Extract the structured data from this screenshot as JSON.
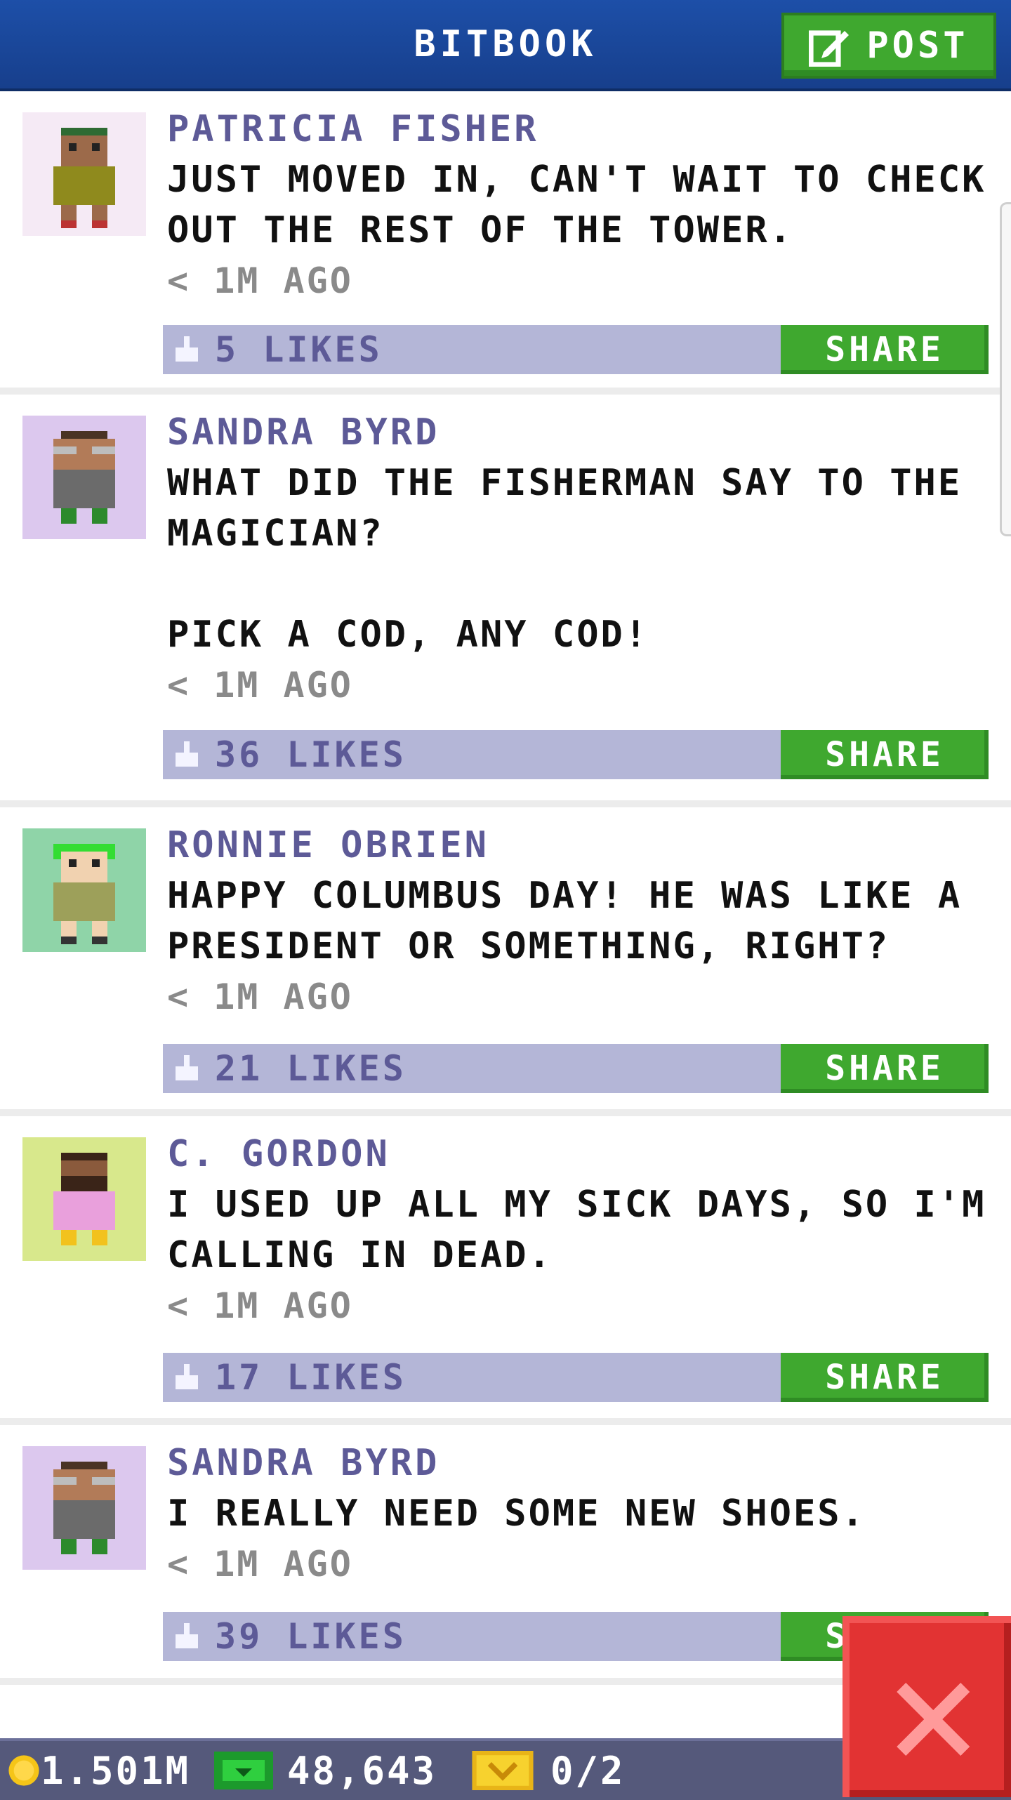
{
  "header": {
    "title": "BITBOOK",
    "post_label": "POST"
  },
  "posts": [
    {
      "author": "PATRICIA FISHER",
      "message": "JUST MOVED IN, CAN'T WAIT TO CHECK OUT THE REST OF THE TOWER.",
      "time": "< 1M AGO",
      "likes": "5 LIKES",
      "share": "SHARE",
      "avatar_bg": "#f5eaf5",
      "skin": "#9c6a4a",
      "shirt": "#8f8a1d"
    },
    {
      "author": "SANDRA BYRD",
      "message": "WHAT DID THE FISHERMAN SAY TO THE MAGICIAN?\n\nPICK A COD, ANY COD!",
      "time": "< 1M AGO",
      "likes": "36 LIKES",
      "share": "SHARE",
      "avatar_bg": "#dcc8ee",
      "skin": "#b27b58",
      "shirt": "#6b6b6b"
    },
    {
      "author": "RONNIE OBRIEN",
      "message": "HAPPY COLUMBUS DAY! HE WAS LIKE A PRESIDENT OR SOMETHING, RIGHT?",
      "time": "< 1M AGO",
      "likes": "21 LIKES",
      "share": "SHARE",
      "avatar_bg": "#8fd4a8",
      "skin": "#f1d2b0",
      "shirt": "#9da05a"
    },
    {
      "author": "C. GORDON",
      "message": "I USED UP ALL MY SICK DAYS, SO I'M CALLING IN DEAD.",
      "time": "< 1M AGO",
      "likes": "17 LIKES",
      "share": "SHARE",
      "avatar_bg": "#d8e88c",
      "skin": "#8a5a3c",
      "shirt": "#e9a0dc"
    },
    {
      "author": "SANDRA BYRD",
      "message": "I REALLY NEED SOME NEW SHOES.",
      "time": "< 1M AGO",
      "likes": "39 LIKES",
      "share": "SHARE",
      "avatar_bg": "#dcc8ee",
      "skin": "#b27b58",
      "shirt": "#6b6b6b"
    }
  ],
  "status": {
    "coins": "1.501M",
    "bux": "48,643",
    "tickets": "0/2"
  },
  "icons": {
    "post": "edit-icon",
    "like": "thumbs-up-icon",
    "coin": "coin-icon",
    "bux": "bux-icon",
    "ticket": "ticket-icon",
    "close": "close-icon"
  }
}
